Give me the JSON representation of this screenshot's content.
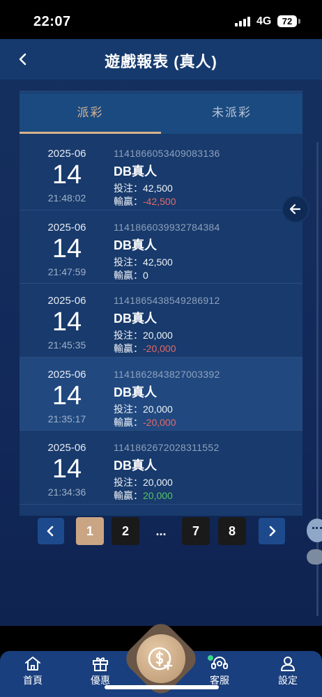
{
  "status": {
    "time": "22:07",
    "network": "4G",
    "battery": "72"
  },
  "header": {
    "title": "遊戲報表 (真人)"
  },
  "tabs": [
    {
      "label": "派彩",
      "active": true
    },
    {
      "label": "未派彩",
      "active": false
    }
  ],
  "labels": {
    "bet": "投注：",
    "win": "輸贏："
  },
  "records": [
    {
      "month": "2025-06",
      "day": "14",
      "time": "21:48:02",
      "id": "1141866053409083136",
      "game": "DB真人",
      "bet": "42,500",
      "win": "-42,500",
      "win_type": "neg"
    },
    {
      "month": "2025-06",
      "day": "14",
      "time": "21:47:59",
      "id": "1141866039932784384",
      "game": "DB真人",
      "bet": "42,500",
      "win": "0",
      "win_type": "zero"
    },
    {
      "month": "2025-06",
      "day": "14",
      "time": "21:45:35",
      "id": "1141865438549286912",
      "game": "DB真人",
      "bet": "20,000",
      "win": "-20,000",
      "win_type": "neg"
    },
    {
      "month": "2025-06",
      "day": "14",
      "time": "21:35:17",
      "id": "1141862843827003392",
      "game": "DB真人",
      "bet": "20,000",
      "win": "-20,000",
      "win_type": "neg"
    },
    {
      "month": "2025-06",
      "day": "14",
      "time": "21:34:36",
      "id": "1141862672028311552",
      "game": "DB真人",
      "bet": "20,000",
      "win": "20,000",
      "win_type": "pos"
    }
  ],
  "pagination": {
    "prev_icon": "chevron-left-icon",
    "next_icon": "chevron-right-icon",
    "pages": [
      "1",
      "2",
      "...",
      "7",
      "8"
    ],
    "current": "1"
  },
  "bottom_nav": [
    {
      "label": "首頁",
      "icon": "home-icon"
    },
    {
      "label": "優惠",
      "icon": "gift-icon"
    },
    {
      "label": "",
      "icon": "dollar-plus-icon"
    },
    {
      "label": "客服",
      "icon": "headset-icon"
    },
    {
      "label": "設定",
      "icon": "user-icon"
    }
  ],
  "colors": {
    "accent": "#d7b592",
    "negative": "#e06a6a",
    "positive": "#55c26a",
    "background": "#12295a",
    "highlight_row": "#214980"
  }
}
